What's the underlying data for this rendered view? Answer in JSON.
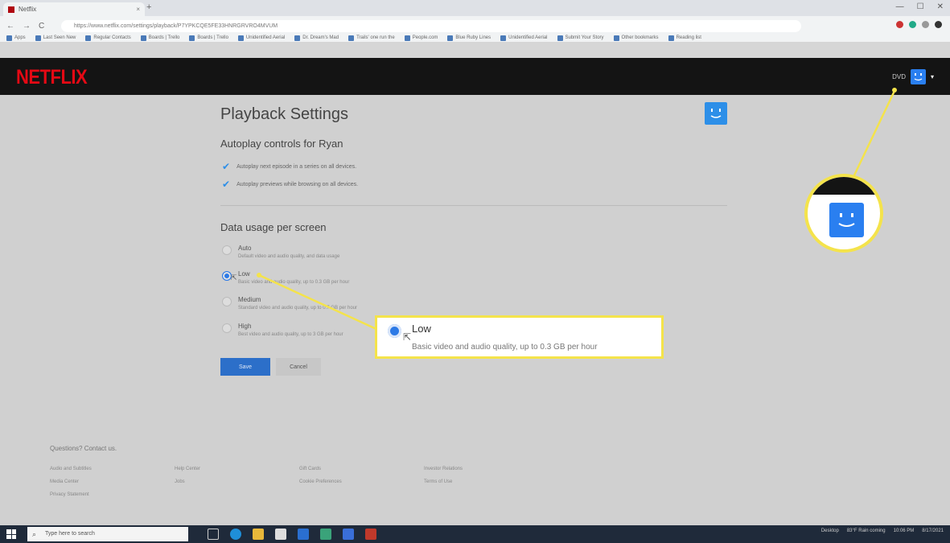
{
  "browser": {
    "tab_title": "Netflix",
    "tab_close": "×",
    "new_tab": "+",
    "win_controls": [
      "—",
      "☐",
      "✕"
    ],
    "nav_buttons": [
      "←",
      "→",
      "C"
    ],
    "url": "https://www.netflix.com/settings/playback/P7YPKCQE5FE33HNRGRVRO4MVUM",
    "bookmarks": [
      "Apps",
      "Last Seen New",
      "Regular Contacts",
      "Boards | Trello",
      "Boards | Trello",
      "Unidentified Aerial",
      "Dr. Dream's Mad",
      "Trails' one run the",
      "People.com",
      "Blue Ruby Lines",
      "Unidentified Aerial",
      "Submit Your Story",
      "Other bookmarks",
      "Reading list"
    ]
  },
  "netflix": {
    "logo": "NETFLIX",
    "dvd_link": "DVD",
    "caret": "▾"
  },
  "page": {
    "title": "Playback Settings",
    "autoplay_heading": "Autoplay controls for Ryan",
    "autoplay_options": [
      "Autoplay next episode in a series on all devices.",
      "Autoplay previews while browsing on all devices."
    ],
    "data_heading": "Data usage per screen",
    "data_options": [
      {
        "label": "Auto",
        "desc": "Default video and audio quality, and data usage",
        "selected": false
      },
      {
        "label": "Low",
        "desc": "Basic video and audio quality, up to 0.3 GB per hour",
        "selected": true
      },
      {
        "label": "Medium",
        "desc": "Standard video and audio quality, up to 0.7 GB per hour",
        "selected": false
      },
      {
        "label": "High",
        "desc": "Best video and audio quality, up to 3 GB per hour",
        "selected": false
      }
    ],
    "save_label": "Save",
    "cancel_label": "Cancel"
  },
  "footer": {
    "questions": "Questions? Contact us.",
    "links": [
      "Audio and Subtitles",
      "Help Center",
      "Gift Cards",
      "Investor Relations",
      "Media Center",
      "Jobs",
      "Cookie Preferences",
      "Terms of Use",
      "Privacy Statement"
    ]
  },
  "callout": {
    "label": "Low",
    "desc": "Basic video and audio quality, up to 0.3 GB per hour",
    "highlight_color": "#f4e34b"
  },
  "taskbar": {
    "search_placeholder": "Type here to search",
    "tray": [
      "Desktop",
      "83°F Rain coming",
      "10:06 PM",
      "8/17/2021"
    ]
  },
  "colors": {
    "netflix_red": "#e50914",
    "accent_blue": "#2d7ae6"
  }
}
